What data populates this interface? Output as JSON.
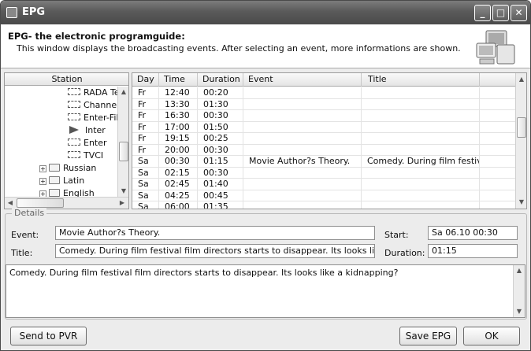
{
  "window": {
    "title": "EPG"
  },
  "header": {
    "heading": "EPG- the electronic programguide:",
    "description": "This window displays the broadcasting events. After selecting an event, more informations are shown."
  },
  "tree": {
    "header": "Station",
    "channels": [
      "RADA Te",
      "Channel",
      "Enter-Film",
      "Inter",
      "Enter",
      "TVCI"
    ],
    "groups": [
      "Russian",
      "Latin",
      "English"
    ]
  },
  "table": {
    "columns": [
      "Day",
      "Time",
      "Duration",
      "Event",
      "Title"
    ],
    "rows": [
      {
        "day": "Fr",
        "time": "12:40",
        "duration": "00:20",
        "event": "",
        "title": ""
      },
      {
        "day": "Fr",
        "time": "13:30",
        "duration": "01:30",
        "event": "",
        "title": ""
      },
      {
        "day": "Fr",
        "time": "16:30",
        "duration": "00:30",
        "event": "",
        "title": ""
      },
      {
        "day": "Fr",
        "time": "17:00",
        "duration": "01:50",
        "event": "",
        "title": ""
      },
      {
        "day": "Fr",
        "time": "19:15",
        "duration": "00:25",
        "event": "",
        "title": ""
      },
      {
        "day": "Fr",
        "time": "20:00",
        "duration": "00:30",
        "event": "",
        "title": ""
      },
      {
        "day": "Sa",
        "time": "00:30",
        "duration": "01:15",
        "event": "Movie Author?s Theory.",
        "title": "Comedy. During film festival..."
      },
      {
        "day": "Sa",
        "time": "02:15",
        "duration": "00:30",
        "event": "",
        "title": ""
      },
      {
        "day": "Sa",
        "time": "02:45",
        "duration": "01:40",
        "event": "",
        "title": ""
      },
      {
        "day": "Sa",
        "time": "04:25",
        "duration": "00:45",
        "event": "",
        "title": ""
      },
      {
        "day": "Sa",
        "time": "06:00",
        "duration": "01:35",
        "event": "",
        "title": ""
      }
    ]
  },
  "details": {
    "legend": "Details",
    "event_label": "Event:",
    "event_value": "Movie Author?s Theory.",
    "title_label": "Title:",
    "title_value": "Comedy. During film festival film directors starts to disappear.  Its looks like a kidnappi",
    "start_label": "Start:",
    "start_value": "Sa 06.10    00:30",
    "duration_label": "Duration:",
    "duration_value": "01:15",
    "description": "Comedy. During film festival film directors starts to disappear.  Its looks like a kidnapping?"
  },
  "buttons": {
    "send_to_pvr": "Send to PVR",
    "save_epg": "Save EPG",
    "ok": "OK"
  },
  "caption_buttons": {
    "minimize": "_",
    "maximize": "□",
    "close": "✕"
  }
}
